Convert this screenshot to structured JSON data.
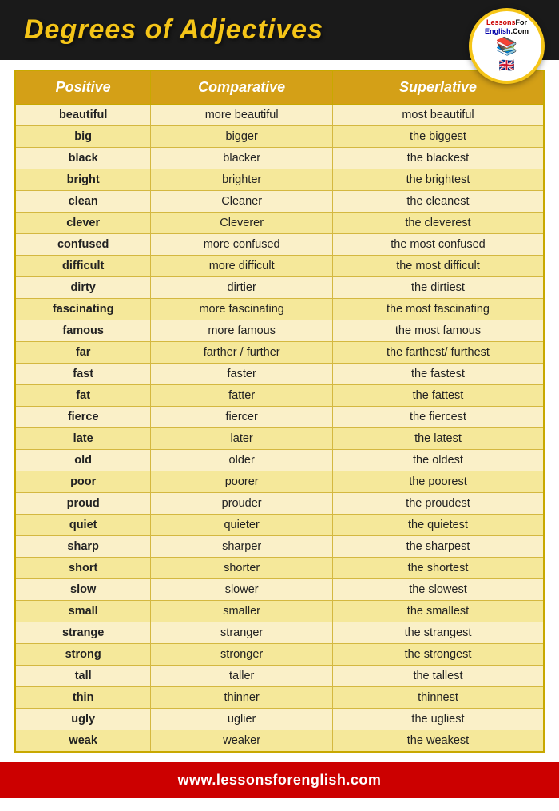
{
  "header": {
    "title": "Degrees of Adjectives"
  },
  "logo": {
    "text_top": "LessonsForEnglish.Com",
    "books_icon": "📚",
    "flag_icon": "🇬🇧"
  },
  "table": {
    "headers": [
      "Positive",
      "Comparative",
      "Superlative"
    ],
    "rows": [
      [
        "beautiful",
        "more beautiful",
        "most beautiful"
      ],
      [
        "big",
        "bigger",
        "the biggest"
      ],
      [
        "black",
        "blacker",
        "the blackest"
      ],
      [
        "bright",
        "brighter",
        "the brightest"
      ],
      [
        "clean",
        "Cleaner",
        "the cleanest"
      ],
      [
        "clever",
        "Cleverer",
        "the cleverest"
      ],
      [
        "confused",
        "more confused",
        "the most confused"
      ],
      [
        "difficult",
        "more difficult",
        "the most difficult"
      ],
      [
        "dirty",
        "dirtier",
        "the dirtiest"
      ],
      [
        "fascinating",
        "more fascinating",
        "the most fascinating"
      ],
      [
        "famous",
        "more famous",
        "the most famous"
      ],
      [
        "far",
        "farther / further",
        "the farthest/ furthest"
      ],
      [
        "fast",
        "faster",
        "the fastest"
      ],
      [
        "fat",
        "fatter",
        "the fattest"
      ],
      [
        "fierce",
        "fiercer",
        "the fiercest"
      ],
      [
        "late",
        "later",
        "the latest"
      ],
      [
        "old",
        "older",
        "the oldest"
      ],
      [
        "poor",
        "poorer",
        "the poorest"
      ],
      [
        "proud",
        "prouder",
        "the proudest"
      ],
      [
        "quiet",
        "quieter",
        "the quietest"
      ],
      [
        "sharp",
        "sharper",
        "the sharpest"
      ],
      [
        "short",
        "shorter",
        "the shortest"
      ],
      [
        "slow",
        "slower",
        "the slowest"
      ],
      [
        "small",
        "smaller",
        "the smallest"
      ],
      [
        "strange",
        "stranger",
        "the strangest"
      ],
      [
        "strong",
        "stronger",
        "the strongest"
      ],
      [
        "tall",
        "taller",
        "the tallest"
      ],
      [
        "thin",
        "thinner",
        "thinnest"
      ],
      [
        "ugly",
        "uglier",
        "the ugliest"
      ],
      [
        "weak",
        "weaker",
        "the weakest"
      ]
    ]
  },
  "footer": {
    "url": "www.lessonsforenglish.com"
  }
}
